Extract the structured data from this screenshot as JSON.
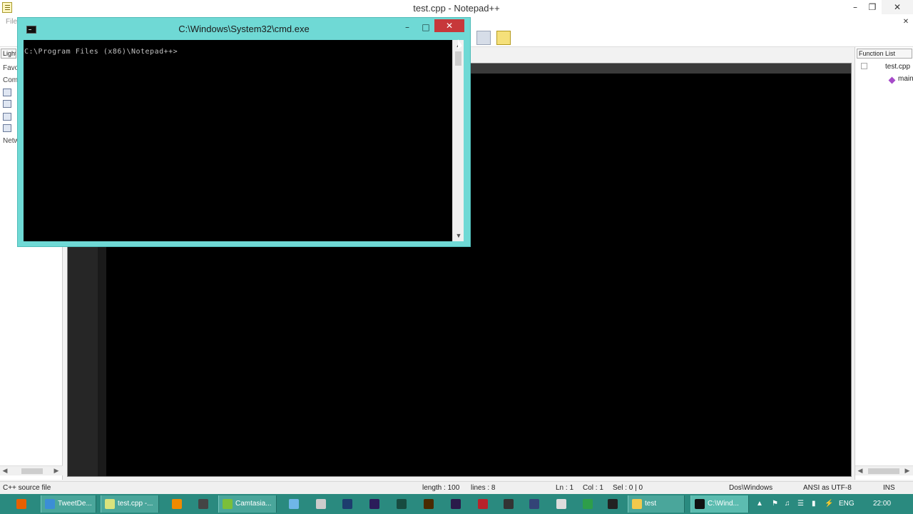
{
  "notepad": {
    "title": "test.cpp - Notepad++",
    "menu_first": "File",
    "left_panel": {
      "tab_label": "Light",
      "rows": [
        "Favo",
        "Com",
        "Netw"
      ]
    },
    "function_list": {
      "header": "Function List",
      "file": "test.cpp",
      "item": "main"
    },
    "status": {
      "file_type": "C++ source file",
      "length": "length : 100",
      "lines": "lines : 8",
      "ln": "Ln : 1",
      "col": "Col : 1",
      "sel": "Sel : 0 | 0",
      "eol": "Dos\\Windows",
      "encoding": "ANSI as UTF-8",
      "mode": "INS"
    },
    "controls": {
      "minimize": "–",
      "restore": "❐",
      "close": "✕"
    }
  },
  "cmd": {
    "title": "C:\\Windows\\System32\\cmd.exe",
    "prompt": "C:\\Program Files (x86)\\Notepad++>",
    "controls": {
      "minimize": "–",
      "maximize": "□",
      "close": "✕"
    }
  },
  "taskbar": {
    "items": [
      {
        "label": "",
        "icon": "firefox-icon",
        "color": "#e66000"
      },
      {
        "label": "TweetDe...",
        "icon": "chrome-icon",
        "color": "#3b8ed6"
      },
      {
        "label": "test.cpp -...",
        "icon": "notepadpp-icon",
        "color": "#d9e37c"
      },
      {
        "label": "",
        "icon": "vlc-icon",
        "color": "#f08a00"
      },
      {
        "label": "",
        "icon": "winamp-icon",
        "color": "#444444"
      },
      {
        "label": "Camtasia...",
        "icon": "camtasia-icon",
        "color": "#7bbf3a"
      },
      {
        "label": "",
        "icon": "network-icon",
        "color": "#6fb6e8"
      },
      {
        "label": "",
        "icon": "app-icon",
        "color": "#cccccc"
      },
      {
        "label": "",
        "icon": "photoshop-icon",
        "color": "#1d3d6e"
      },
      {
        "label": "",
        "icon": "premiere-icon",
        "color": "#2b1c5a"
      },
      {
        "label": "",
        "icon": "audition-icon",
        "color": "#174b40"
      },
      {
        "label": "",
        "icon": "illustrator-icon",
        "color": "#4a2a00"
      },
      {
        "label": "",
        "icon": "after-effects-icon",
        "color": "#2a1a4a"
      },
      {
        "label": "",
        "icon": "filezilla-icon",
        "color": "#b8232a"
      },
      {
        "label": "",
        "icon": "media-icon",
        "color": "#333333"
      },
      {
        "label": "",
        "icon": "obs-icon",
        "color": "#334477"
      },
      {
        "label": "",
        "icon": "settings-icon",
        "color": "#dddddd"
      },
      {
        "label": "",
        "icon": "phone-icon",
        "color": "#2e9e4a"
      },
      {
        "label": "",
        "icon": "clapper-icon",
        "color": "#222222"
      },
      {
        "label": "test",
        "icon": "folder-icon",
        "color": "#f2c94c"
      },
      {
        "label": "C:\\Wind...",
        "icon": "cmd-icon",
        "color": "#111111"
      }
    ],
    "tray": {
      "language": "ENG",
      "time": "22:00"
    }
  }
}
